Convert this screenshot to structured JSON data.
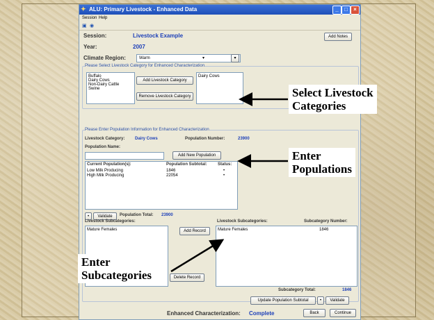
{
  "window": {
    "title": "ALU: Primary Livestock - Enhanced Data"
  },
  "menu": {
    "session": "Session",
    "help": "Help"
  },
  "header": {
    "session_label": "Session:",
    "session_value": "Livestock Example",
    "year_label": "Year:",
    "year_value": "2007",
    "climate_label": "Climate Region:",
    "climate_value": "Warm",
    "add_notes": "Add Notes"
  },
  "categories_group": {
    "label": "Please Select Livestock Category for Enhanced Characterization",
    "available": [
      "Buffalo",
      "Dairy Cows",
      "Non-Dairy Cattle",
      "Swine"
    ],
    "selected": [
      "Dairy Cows"
    ],
    "add_btn": "Add Livestock Category",
    "remove_btn": "Remove Livestock Category"
  },
  "population_group": {
    "label": "Please Enter Population Information for Enhanced Characterization",
    "category_label": "Livestock Category:",
    "category_value": "Dairy Cows",
    "pop_number_label": "Population Number:",
    "pop_number_value": "23900",
    "pop_name_label": "Population Name:",
    "pop_name_value": "",
    "add_pop_btn": "Add New Population",
    "current_label": "Current Population(s):",
    "subtotal_label": "Population Subtotal:",
    "status_label": "Status:",
    "rows": [
      {
        "name": "Low Milk Producing",
        "subtotal": "1846",
        "status": "•"
      },
      {
        "name": "High Milk Producing",
        "subtotal": "22054",
        "status": "•"
      }
    ],
    "validate_btn": "Validate",
    "total_label": "Population Total:",
    "total_value": "23900",
    "sub_label": "Livestock Subcategories:",
    "sub_list": [
      "Mature Females"
    ],
    "add_record_btn": "Add Record",
    "delete_record_btn": "Delete Record",
    "sub_right_label": "Livestock Subcategories:",
    "sub_number_label": "Subcategory Number:",
    "sub_right_rows": [
      {
        "name": "Mature Females",
        "number": "1846"
      }
    ],
    "sub_total_label": "Subcategory Total:",
    "sub_total_value": "1846",
    "update_btn": "Update Population Subtotal",
    "validate2_btn": "Validate"
  },
  "footer": {
    "enhanced_label": "Enhanced Characterization:",
    "enhanced_value": "Complete",
    "back_btn": "Back",
    "continue_btn": "Continue"
  },
  "callouts": {
    "select": [
      "Select Livestock",
      "Categories"
    ],
    "enter_pop": [
      "Enter",
      "Populations"
    ],
    "enter_sub": [
      "Enter",
      "Subcategories"
    ]
  },
  "colors": {
    "accent": "#1c3fb8",
    "titlebar": "#2457c5",
    "complete": "#1c3fb8"
  }
}
